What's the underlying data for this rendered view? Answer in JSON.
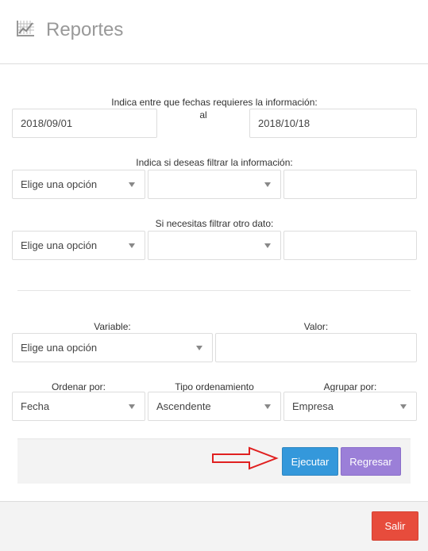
{
  "header": {
    "title": "Reportes"
  },
  "dates": {
    "instruction": "Indica entre que fechas requieres la información:",
    "separator": "al",
    "start_value": "2018/09/01",
    "end_value": "2018/10/18"
  },
  "filter1": {
    "label": "Indica si deseas filtrar la información:",
    "field_select_value": "Elige una opción",
    "value_select_value": "",
    "text_value": ""
  },
  "filter2": {
    "label": "Si necesitas filtrar otro dato:",
    "field_select_value": "Elige una opción",
    "value_select_value": "",
    "text_value": ""
  },
  "variable": {
    "label": "Variable:",
    "select_value": "Elige una opción"
  },
  "valor": {
    "label": "Valor:",
    "value": ""
  },
  "ordenar": {
    "label": "Ordenar por:",
    "value": "Fecha"
  },
  "tipo": {
    "label": "Tipo ordenamiento",
    "value": "Ascendente"
  },
  "agrupar": {
    "label": "Agrupar por:",
    "value": "Empresa"
  },
  "actions": {
    "ejecutar_label": "Ejecutar",
    "regresar_label": "Regresar"
  },
  "footer": {
    "salir_label": "Salir"
  },
  "colors": {
    "ejecutar": "#3498db",
    "regresar": "#9b7fd8",
    "salir": "#e74c3c",
    "annotation_arrow": "#e02020"
  }
}
